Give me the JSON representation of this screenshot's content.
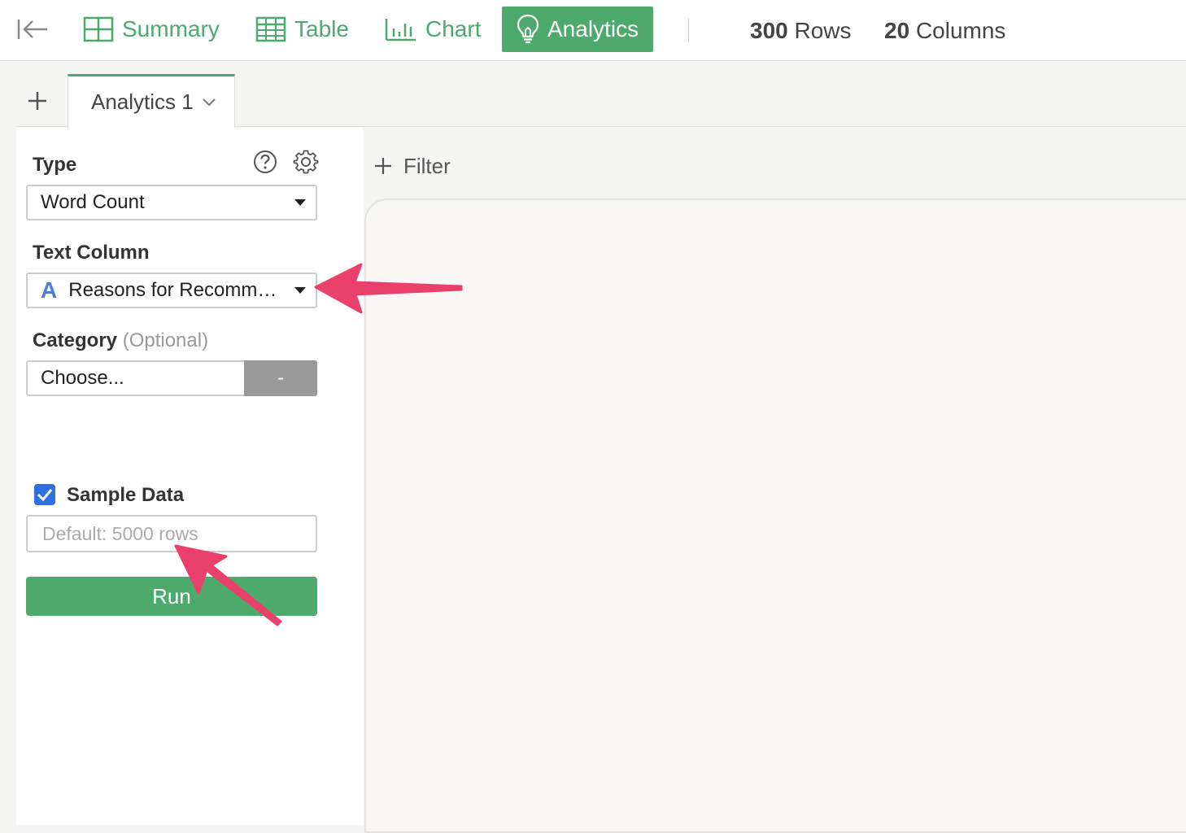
{
  "topbar": {
    "nav": [
      {
        "label": "Summary",
        "icon": "grid-icon"
      },
      {
        "label": "Table",
        "icon": "table-icon"
      },
      {
        "label": "Chart",
        "icon": "bar-chart-icon"
      },
      {
        "label": "Analytics",
        "icon": "lightbulb-icon",
        "active": true
      }
    ],
    "rows_count": "300",
    "rows_label": "Rows",
    "cols_count": "20",
    "cols_label": "Columns"
  },
  "tabs": [
    {
      "label": "Analytics 1"
    }
  ],
  "panel": {
    "type_label": "Type",
    "type_value": "Word Count",
    "text_column_label": "Text Column",
    "text_column_type_icon": "A",
    "text_column_value": "Reasons for Recommending",
    "category_label": "Category",
    "category_optional": "(Optional)",
    "category_placeholder": "Choose...",
    "category_minus": "-",
    "sample_data_label": "Sample Data",
    "sample_data_checked": true,
    "sample_placeholder": "Default: 5000 rows",
    "run_label": "Run"
  },
  "filter_label": "Filter",
  "colors": {
    "accent": "#4ea96d",
    "annotation": "#e9416c",
    "checkbox": "#2f6fe0"
  }
}
